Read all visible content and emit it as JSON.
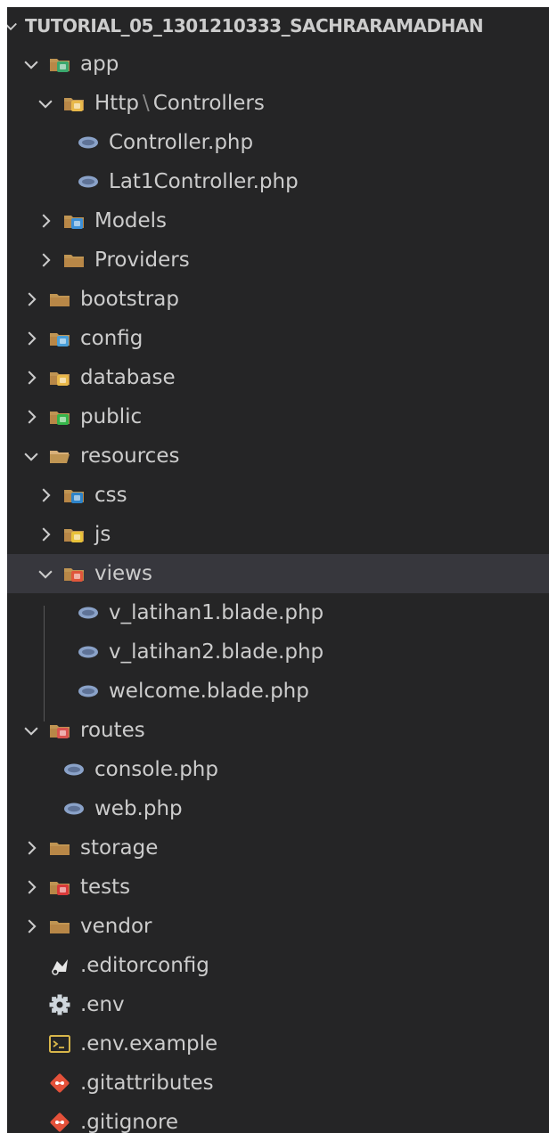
{
  "explorer": {
    "root": {
      "label": "TUTORIAL_05_1301210333_SACHRARAMADHAN",
      "expanded": true
    },
    "items": [
      {
        "id": "app",
        "label": "app",
        "depth": 1,
        "type": "folder",
        "expanded": true,
        "icon": "folder-app-icon",
        "color": "#3aa76d"
      },
      {
        "id": "http-controllers",
        "label": "Http",
        "label2": "Controllers",
        "sep": "\\",
        "depth": 2,
        "type": "folder",
        "expanded": true,
        "icon": "folder-controller-icon",
        "color": "#e8b84a"
      },
      {
        "id": "controller-php",
        "label": "Controller.php",
        "depth": 3,
        "type": "file",
        "icon": "php-file-icon",
        "color": "#8aa2c8"
      },
      {
        "id": "lat1controller-php",
        "label": "Lat1Controller.php",
        "depth": 3,
        "type": "file",
        "icon": "php-file-icon",
        "color": "#8aa2c8"
      },
      {
        "id": "models",
        "label": "Models",
        "depth": 2,
        "type": "folder",
        "expanded": false,
        "icon": "folder-models-icon",
        "color": "#3d8fd6"
      },
      {
        "id": "providers",
        "label": "Providers",
        "depth": 2,
        "type": "folder",
        "expanded": false,
        "icon": "folder-icon",
        "color": "#c09553"
      },
      {
        "id": "bootstrap",
        "label": "bootstrap",
        "depth": 1,
        "type": "folder",
        "expanded": false,
        "icon": "folder-icon",
        "color": "#c09553"
      },
      {
        "id": "config",
        "label": "config",
        "depth": 1,
        "type": "folder",
        "expanded": false,
        "icon": "folder-config-icon",
        "color": "#4a9fd8"
      },
      {
        "id": "database",
        "label": "database",
        "depth": 1,
        "type": "folder",
        "expanded": false,
        "icon": "folder-database-icon",
        "color": "#e8b84a"
      },
      {
        "id": "public",
        "label": "public",
        "depth": 1,
        "type": "folder",
        "expanded": false,
        "icon": "folder-public-icon",
        "color": "#35b54a"
      },
      {
        "id": "resources",
        "label": "resources",
        "depth": 1,
        "type": "folder",
        "expanded": true,
        "icon": "folder-open-icon",
        "color": "#c09553"
      },
      {
        "id": "css",
        "label": "css",
        "depth": 2,
        "type": "folder",
        "expanded": false,
        "icon": "folder-css-icon",
        "color": "#2e84c9"
      },
      {
        "id": "js",
        "label": "js",
        "depth": 2,
        "type": "folder",
        "expanded": false,
        "icon": "folder-js-icon",
        "color": "#e8c23a"
      },
      {
        "id": "views",
        "label": "views",
        "depth": 2,
        "type": "folder",
        "expanded": true,
        "selected": true,
        "icon": "folder-views-icon",
        "color": "#e0563b"
      },
      {
        "id": "v-latihan1",
        "label": "v_latihan1.blade.php",
        "depth": 3,
        "type": "file",
        "icon": "php-file-icon",
        "color": "#8aa2c8"
      },
      {
        "id": "v-latihan2",
        "label": "v_latihan2.blade.php",
        "depth": 3,
        "type": "file",
        "icon": "php-file-icon",
        "color": "#8aa2c8"
      },
      {
        "id": "welcome",
        "label": "welcome.blade.php",
        "depth": 3,
        "type": "file",
        "icon": "php-file-icon",
        "color": "#8aa2c8"
      },
      {
        "id": "routes",
        "label": "routes",
        "depth": 1,
        "type": "folder",
        "expanded": true,
        "icon": "folder-routes-icon",
        "color": "#d9534f"
      },
      {
        "id": "console-php",
        "label": "console.php",
        "depth": 2,
        "type": "file",
        "icon": "php-file-icon",
        "color": "#8aa2c8"
      },
      {
        "id": "web-php",
        "label": "web.php",
        "depth": 2,
        "type": "file",
        "icon": "php-file-icon",
        "color": "#8aa2c8"
      },
      {
        "id": "storage",
        "label": "storage",
        "depth": 1,
        "type": "folder",
        "expanded": false,
        "icon": "folder-icon",
        "color": "#c09553"
      },
      {
        "id": "tests",
        "label": "tests",
        "depth": 1,
        "type": "folder",
        "expanded": false,
        "icon": "folder-tests-icon",
        "color": "#d93a3a"
      },
      {
        "id": "vendor",
        "label": "vendor",
        "depth": 1,
        "type": "folder",
        "expanded": false,
        "icon": "folder-icon",
        "color": "#c09553"
      },
      {
        "id": "editorconfig",
        "label": ".editorconfig",
        "depth": 1,
        "type": "file",
        "icon": "editorconfig-icon",
        "color": "#e6e6e6"
      },
      {
        "id": "env",
        "label": ".env",
        "depth": 1,
        "type": "file",
        "icon": "gear-icon",
        "color": "#cfd6dc"
      },
      {
        "id": "env-example",
        "label": ".env.example",
        "depth": 1,
        "type": "file",
        "icon": "terminal-file-icon",
        "color": "#d8b64a"
      },
      {
        "id": "gitattributes",
        "label": ".gitattributes",
        "depth": 1,
        "type": "file",
        "icon": "git-icon",
        "color": "#e4513a"
      },
      {
        "id": "gitignore",
        "label": ".gitignore",
        "depth": 1,
        "type": "file",
        "icon": "git-icon",
        "color": "#e4513a"
      }
    ]
  }
}
